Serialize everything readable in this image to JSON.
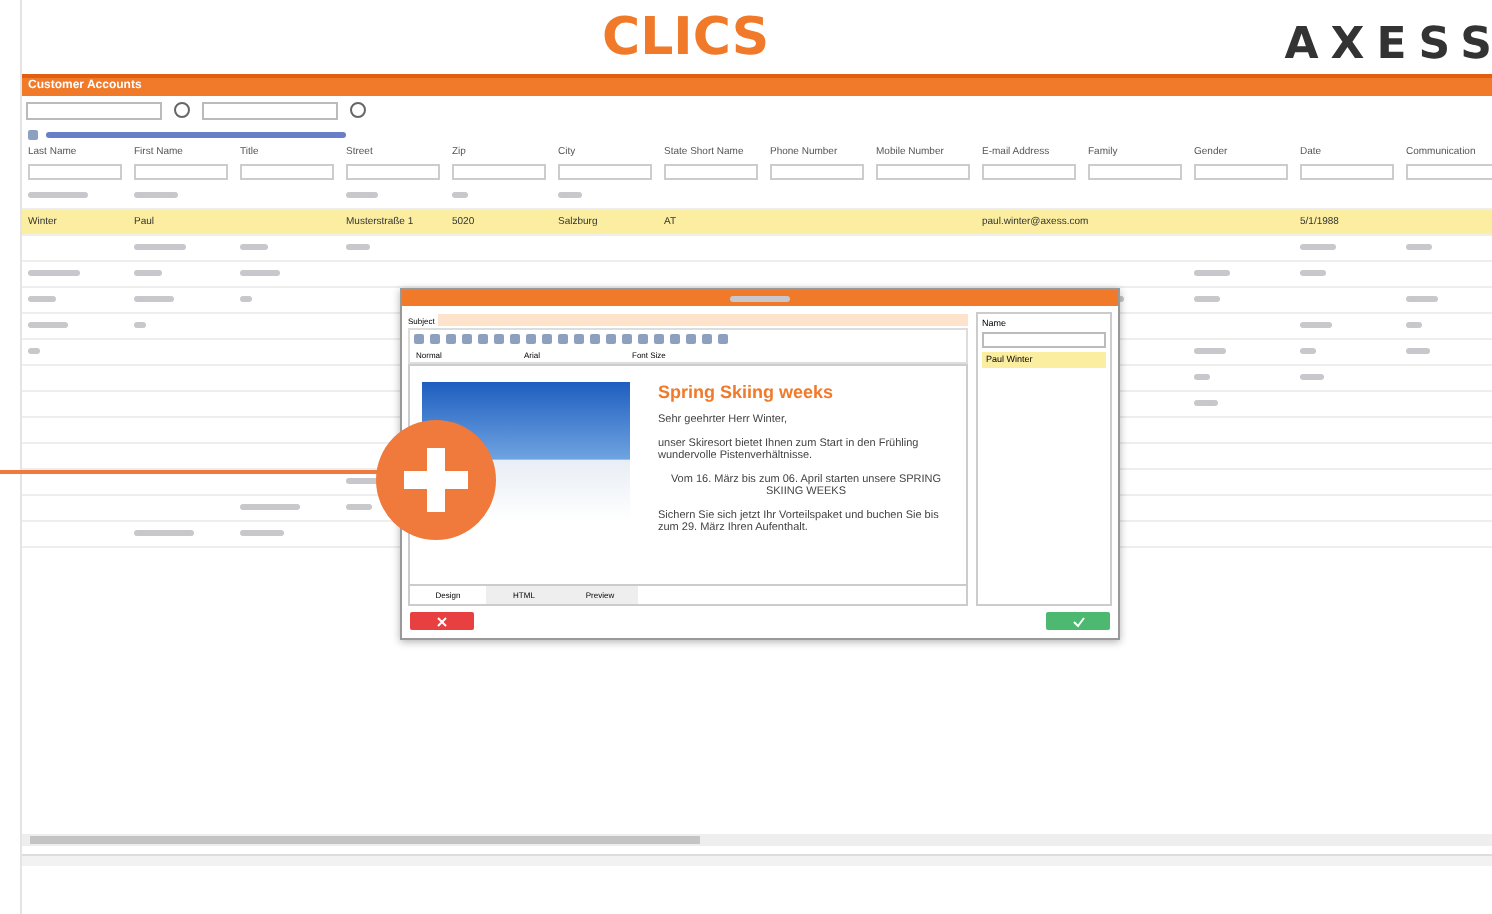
{
  "header": {
    "app_name": "CLICS",
    "brand": "AXESS"
  },
  "panel": {
    "title": "Customer Accounts"
  },
  "table": {
    "columns": [
      "Last Name",
      "First Name",
      "Title",
      "Street",
      "Zip",
      "City",
      "State Short Name",
      "Phone Number",
      "Mobile Number",
      "E-mail Address",
      "Family",
      "Gender",
      "Date",
      "Communication"
    ],
    "rows": [
      {
        "selected": false,
        "cells": []
      },
      {
        "selected": true,
        "cells": [
          "Winter",
          "Paul",
          "",
          "Musterstraße 1",
          "5020",
          "Salzburg",
          "AT",
          "",
          "",
          "paul.winter@axess.com",
          "",
          "",
          "5/1/1988",
          ""
        ]
      },
      {
        "selected": false,
        "cells": []
      },
      {
        "selected": false,
        "cells": []
      },
      {
        "selected": false,
        "cells": []
      },
      {
        "selected": false,
        "cells": []
      },
      {
        "selected": false,
        "cells": []
      },
      {
        "selected": false,
        "cells": []
      },
      {
        "selected": false,
        "cells": []
      },
      {
        "selected": false,
        "cells": []
      },
      {
        "selected": false,
        "cells": []
      },
      {
        "selected": false,
        "cells": []
      },
      {
        "selected": false,
        "cells": []
      },
      {
        "selected": false,
        "cells": []
      }
    ]
  },
  "dialog": {
    "subject_label": "Subject",
    "format": "Normal",
    "font": "Arial",
    "font_size": "Font Size",
    "heading": "Spring Skiing weeks",
    "paragraphs": [
      {
        "text": "Sehr geehrter Herr Winter,",
        "centered": false
      },
      {
        "text": "unser Skiresort bietet Ihnen zum Start in den Frühling wundervolle Pistenverhältnisse.",
        "centered": false
      },
      {
        "text": "Vom 16. März bis zum 06. April starten unsere SPRING SKIING WEEKS",
        "centered": true
      },
      {
        "text": "Sichern Sie sich jetzt Ihr Vorteilspaket und buchen Sie bis zum 29. März Ihren Aufenthalt.",
        "centered": false
      }
    ],
    "tabs": [
      {
        "label": "Design",
        "selected": true
      },
      {
        "label": "HTML",
        "selected": false
      },
      {
        "label": "Preview",
        "selected": false
      }
    ],
    "name_label": "Name",
    "recipients": [
      {
        "name": "Paul Winter",
        "selected": true
      }
    ]
  }
}
